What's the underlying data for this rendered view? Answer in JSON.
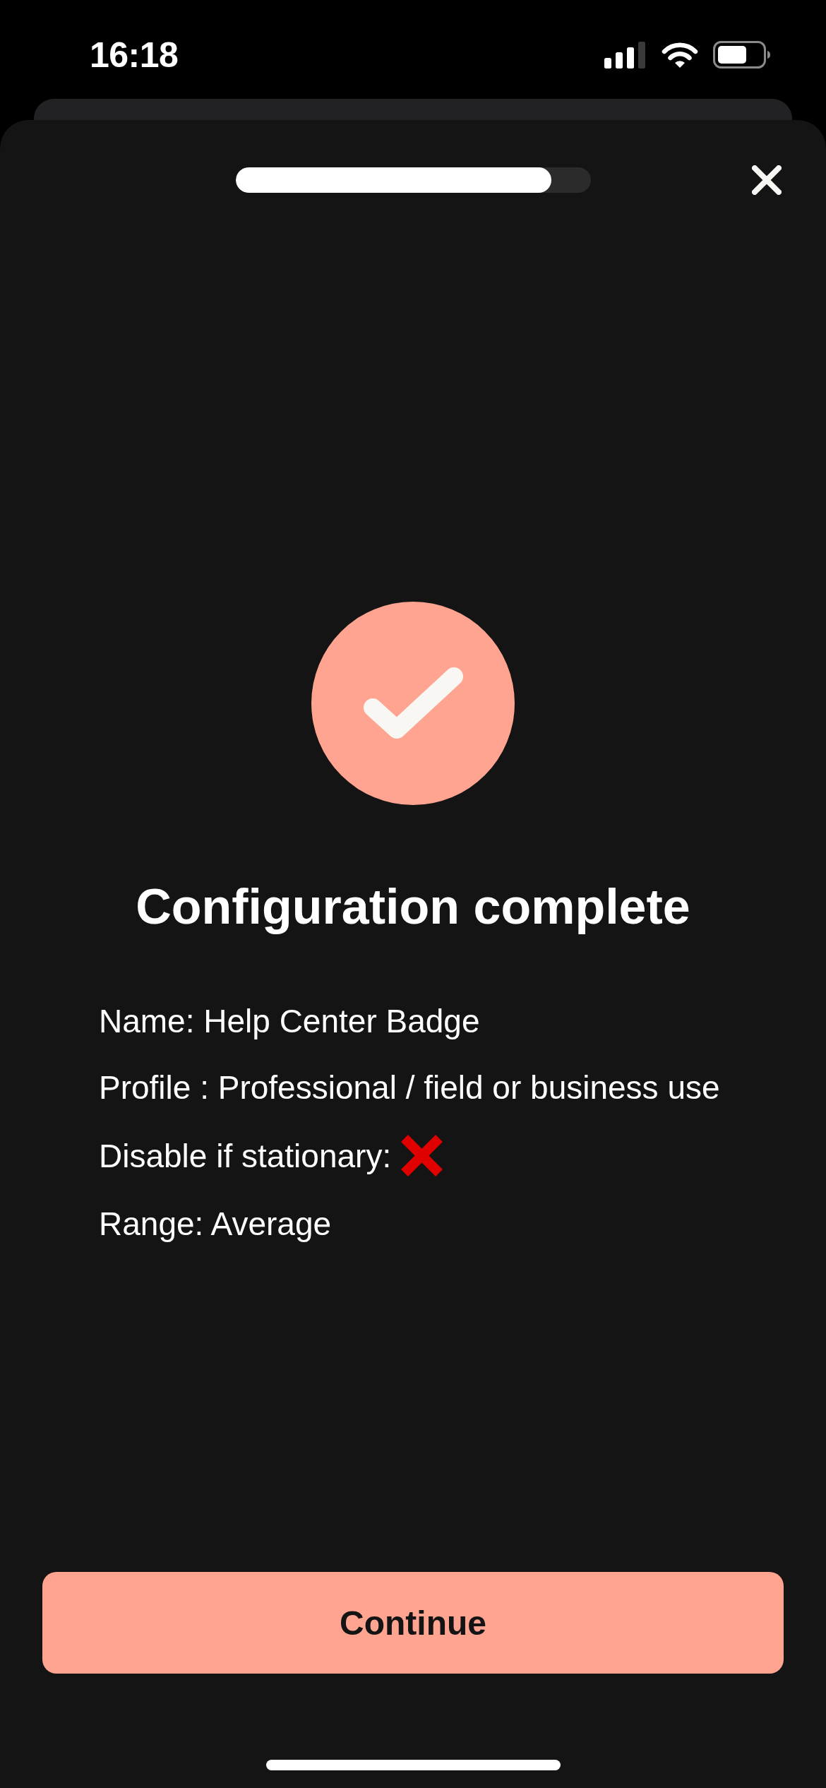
{
  "status_bar": {
    "time": "16:18"
  },
  "progress": {
    "level": 0.89
  },
  "title": "Configuration complete",
  "details": [
    {
      "kind": "text",
      "text": "Name: Help Center Badge"
    },
    {
      "kind": "text",
      "text": "Profile : Professional / field or business use"
    },
    {
      "kind": "flag",
      "text": "Disable if stationary:",
      "on": false
    },
    {
      "kind": "text",
      "text": "Range: Average"
    }
  ],
  "primary_button": {
    "label": "Continue"
  }
}
